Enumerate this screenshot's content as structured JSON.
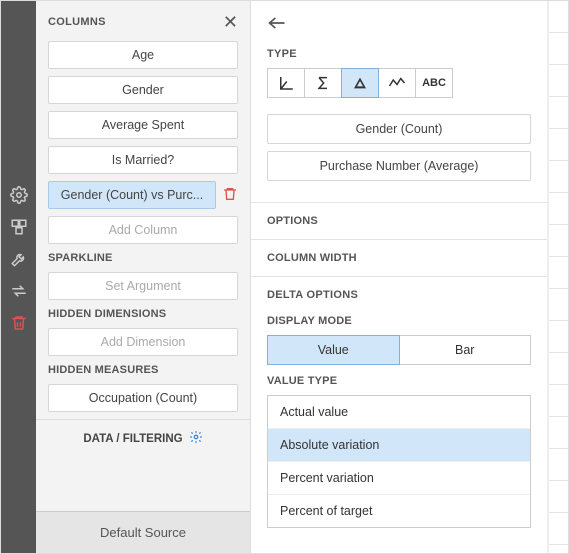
{
  "columns": {
    "title": "COLUMNS",
    "items": [
      "Age",
      "Gender",
      "Average Spent",
      "Is Married?"
    ],
    "selected": "Gender (Count) vs Purc...",
    "add_label": "Add Column"
  },
  "sparkline": {
    "title": "SPARKLINE",
    "placeholder": "Set Argument"
  },
  "hidden_dimensions": {
    "title": "HIDDEN DIMENSIONS",
    "placeholder": "Add Dimension"
  },
  "hidden_measures": {
    "title": "HIDDEN MEASURES",
    "item": "Occupation (Count)"
  },
  "data_filtering": "DATA / FILTERING",
  "default_source": "Default Source",
  "type": {
    "title": "TYPE",
    "abc": "ABC",
    "fields": [
      "Gender (Count)",
      "Purchase Number (Average)"
    ]
  },
  "options_title": "OPTIONS",
  "column_width_title": "COLUMN WIDTH",
  "delta": {
    "title": "DELTA OPTIONS",
    "display_mode_label": "DISPLAY MODE",
    "display_modes": [
      "Value",
      "Bar"
    ],
    "value_type_label": "VALUE TYPE",
    "value_types": [
      "Actual value",
      "Absolute variation",
      "Percent variation",
      "Percent of target"
    ]
  }
}
